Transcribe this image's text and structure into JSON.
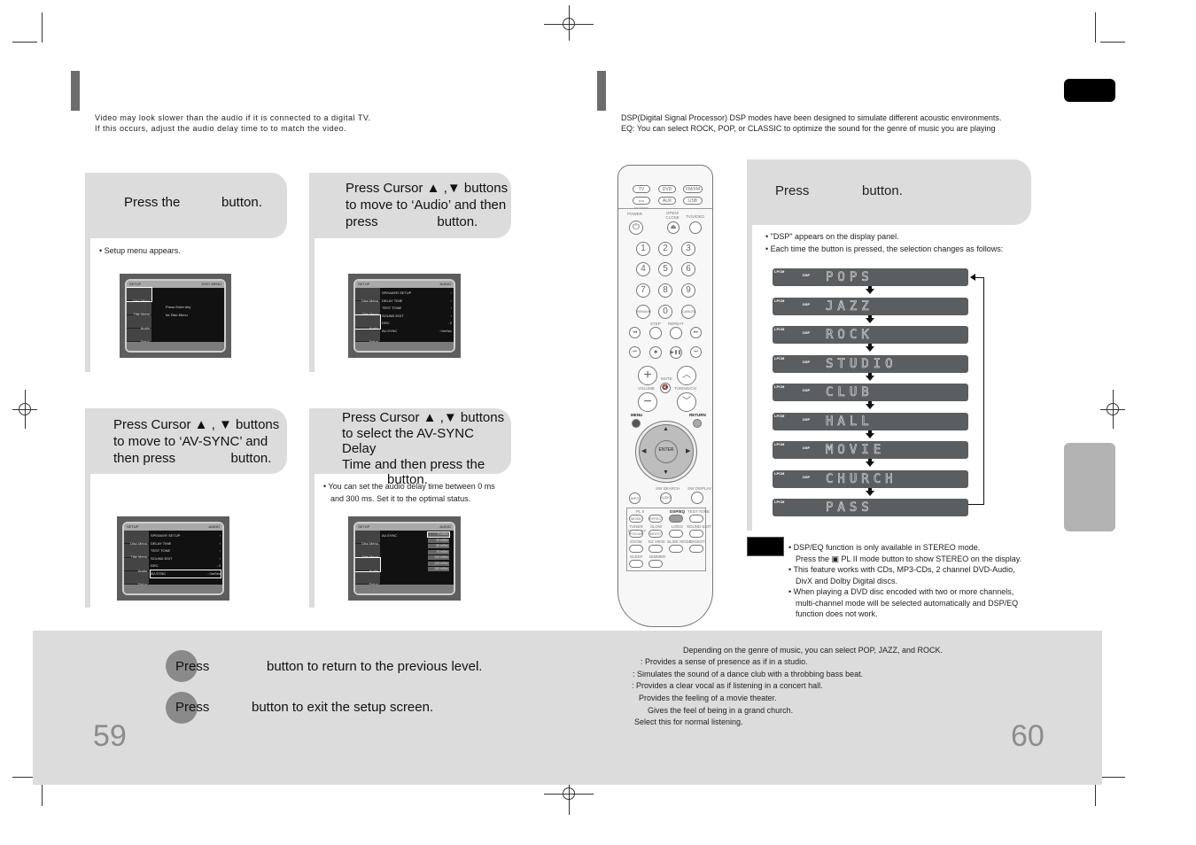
{
  "left_page": {
    "intro": [
      "Video may look slower than the audio if it is connected to a digital TV.",
      "If this occurs, adjust the audio delay time to to match the video."
    ],
    "steps": [
      {
        "text_parts": [
          "Press the",
          "button."
        ],
        "bullet": "Setup menu appears."
      },
      {
        "lines": [
          "Press Cursor ▲ ,▼ buttons",
          "to move to ‘Audio’ and then",
          "press                button."
        ]
      },
      {
        "lines": [
          "Press Cursor ▲ , ▼ buttons",
          "to move to ‘AV-SYNC’ and",
          "then press               button."
        ]
      },
      {
        "lines": [
          "Press Cursor ▲ ,▼ buttons",
          "to select the AV-SYNC Delay",
          "Time  and then press the",
          "button."
        ],
        "bullet_lines": [
          "You can set the audio delay time between 0 ms",
          "and 300 ms. Set it to the optimal status."
        ]
      }
    ],
    "screens": {
      "sidebar": [
        "Disc Menu",
        "Title Menu",
        "Audio",
        "Setup"
      ],
      "screen1": {
        "header_right": "DISC MENU",
        "message": [
          "Press Enter key",
          "for Disc Menu"
        ],
        "selected": "Disc Menu"
      },
      "screen2": {
        "header_right": "AUDIO",
        "selected": "Audio",
        "rows": [
          {
            "label": "SPEAKER SETUP",
            "value": "›"
          },
          {
            "label": "DELAY TIME",
            "value": "›"
          },
          {
            "label": "TEST TONE",
            "value": "›"
          },
          {
            "label": "SOUND EDIT",
            "value": "›"
          },
          {
            "label": "DRC",
            "value": ": 2"
          },
          {
            "label": "AV-SYNC",
            "value": ": 0mSec"
          }
        ]
      },
      "screen3": {
        "header_right": "AUDIO",
        "selected_row": "AV-SYNC"
      },
      "screen4": {
        "header_right": "AUDIO",
        "row": "AV-SYNC",
        "delay_options": [
          "0 mSec",
          "25 mSec",
          "50 mSec",
          "75 mSec",
          "100 mSec",
          "125 mSec",
          "150 mSec"
        ],
        "selected_option": "0 mSec"
      }
    },
    "footer": {
      "return_text_prefix": "Press",
      "return_text": "button to return to the previous level.",
      "exit_text_prefix": "Press",
      "exit_text": "button to exit the setup screen.",
      "page_number": "59"
    }
  },
  "right_page": {
    "intro": [
      "DSP(Digital Signal Processor) DSP modes have been designed to simulate different acoustic environments.",
      "EQ: You can select ROCK, POP, or CLASSIC to optimize the sound for the genre of music you are playing"
    ],
    "step": {
      "text_parts": [
        "Press",
        "button."
      ]
    },
    "bullets": [
      "\"DSP\" appears on the display panel.",
      "Each time the button is pressed, the selection changes as follows:"
    ],
    "display_indicator_lpcm": "LPCM",
    "display_indicator_dsp": "DSP",
    "modes": [
      "POPS",
      "JAZZ",
      "ROCK",
      "STUDIO",
      "CLUB",
      "HALL",
      "MOVIE",
      "CHURCH",
      "PASS"
    ],
    "notes": [
      [
        "DSP/EQ function is only available in STEREO mode.",
        "Press the  ▣ PL II mode button to show STEREO on the display."
      ],
      [
        "This feature works with CDs, MP3-CDs, 2 channel DVD-Audio,",
        "DivX and Dolby Digital discs."
      ],
      [
        "When playing a DVD disc encoded with two or more channels,",
        "multi-channel mode will be selected automatically and DSP/EQ",
        "function does not work."
      ]
    ],
    "descriptions": [
      "Depending on the genre of music, you can select POP, JAZZ, and ROCK.",
      ": Provides a sense of presence as if in a studio.",
      ": Simulates the sound of a dance club with a throbbing bass beat.",
      ": Provides a clear vocal as if listening in a concert hall.",
      "Provides the feeling of a movie theater.",
      "Gives the feel of being in a grand church.",
      "Select this for normal listening."
    ],
    "page_number": "60",
    "remote": {
      "source_buttons": [
        "TV",
        "DVD",
        "FM/XM",
        "DVD RECEIVER",
        "AUX",
        "USB"
      ],
      "labels": {
        "power": "POWER",
        "open_close": "OPEN/ CLOSE",
        "tv_video": "TV/VIDEO",
        "step": "STEP",
        "repeat": "REPEAT",
        "mute": "MUTE",
        "volume": "VOLUME",
        "tuning": "TUNING/CH",
        "menu": "MENU",
        "return": "RETURN",
        "enter": "ENTER",
        "sw_search": "SW SEARCH",
        "sw_display": "SW DISPLAY",
        "info": "INFO",
        "audio": "AUDIO",
        "dpl2": "PL II",
        "mode": "MODE",
        "effect": "EFFECT",
        "dsp_eq": "DSP/EQ",
        "test_tone": "TEST TONE",
        "tuner_memory": "TUNER MEMORY",
        "slow": "SLOW",
        "logo": "LOGO",
        "sound_edit": "SOUND EDIT",
        "p_scan": "P.SCAN",
        "mo_st": "MO/ST",
        "zoom": "ZOOM",
        "ez_view": "EZ VIEW",
        "slide_mode": "SLIDE MODE",
        "digest": "DIGEST",
        "sleep": "SLEEP",
        "dimmer": "DIMMER",
        "remain": "REMAIN",
        "cancel": "CANCEL"
      },
      "digits": [
        "1",
        "2",
        "3",
        "4",
        "5",
        "6",
        "7",
        "8",
        "9",
        "0"
      ]
    }
  },
  "colors": {
    "panel_gray": "#dcdcdc",
    "title_bar": "#6d6d6d",
    "lcd": "#5b5e61",
    "tab_gray": "#b3b3b3",
    "page_number": "#8c8c8c"
  }
}
